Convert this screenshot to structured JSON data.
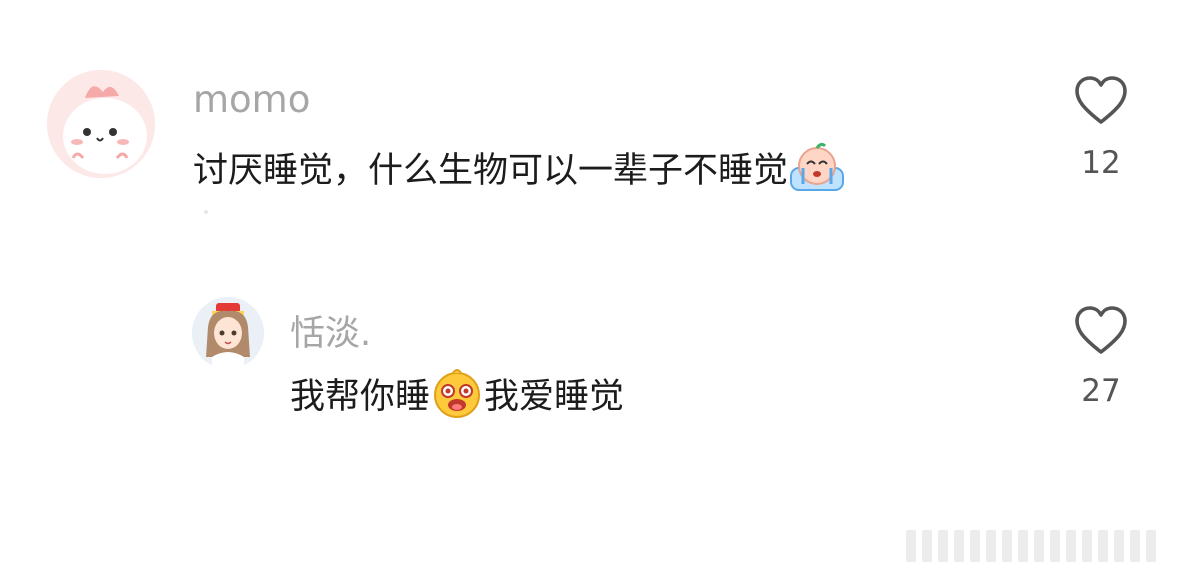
{
  "comments": [
    {
      "username": "momo",
      "text_before": "讨厌睡觉，什么生物可以一辈子不睡觉",
      "emoji": "crying-face-icon",
      "text_after": "",
      "likes": "12"
    },
    {
      "username": "恬淡.",
      "text_before": "我帮你睡",
      "emoji": "drooling-face-icon",
      "text_after": "我爱睡觉",
      "likes": "27"
    }
  ],
  "colors": {
    "username": "#a6a6a6",
    "text": "#1c1c1c",
    "like_icon": "#555555"
  }
}
